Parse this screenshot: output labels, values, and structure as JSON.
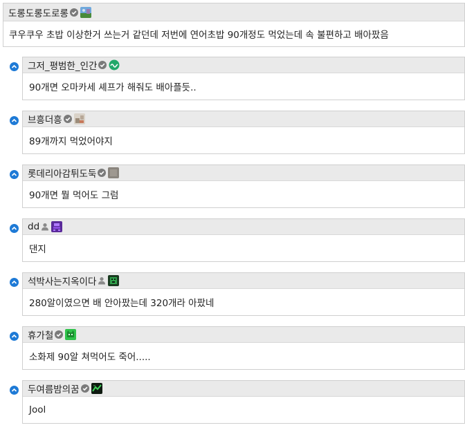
{
  "post": {
    "author": "도롱도롱도로롱",
    "badge_icon": "verified-check-icon",
    "avatar_icon": "landscape-avatar-icon",
    "text": "쿠우쿠우 초밥 이상한거 쓰는거 같던데 저번에 연어초밥 90개정도 먹었는데 속 불편하고 배아팠음"
  },
  "replies": [
    {
      "author": "그저_평범한_인간",
      "badge": "verified-check-icon",
      "avatar": "green-circle-avatar-icon",
      "text": "90개면 오마카세 셰프가 해줘도 배아플듯.."
    },
    {
      "author": "브흥더흥",
      "badge": "verified-check-icon",
      "avatar": "photo-avatar-icon",
      "text": "89개까지 먹었어야지"
    },
    {
      "author": "롯데리아감튀도둑",
      "badge": "verified-check-icon",
      "avatar": "gray-avatar-icon",
      "text": "90개면 뭘 먹어도 그럼"
    },
    {
      "author": "dd",
      "badge": "user-icon",
      "avatar": "purple-pixel-avatar-icon",
      "text": "댄지"
    },
    {
      "author": "석박사는지옥이다",
      "badge": "user-icon",
      "avatar": "green-pixel-avatar-icon",
      "text": "280알이였으면 배 안아팠는데 320개라 아팠네"
    },
    {
      "author": "휴가철",
      "badge": "verified-check-icon",
      "avatar": "green-cat-avatar-icon",
      "text": "소화제 90알 쳐먹어도 죽어....."
    },
    {
      "author": "두여름밤의꿈",
      "badge": "verified-check-icon",
      "avatar": "dark-green-avatar-icon",
      "text": "Jool"
    }
  ],
  "reply_marker_icon": "reply-arrow-up-icon",
  "colors": {
    "header_bg": "#eaeaea",
    "border": "#cfcfcf",
    "marker": "#1e7ad6"
  }
}
